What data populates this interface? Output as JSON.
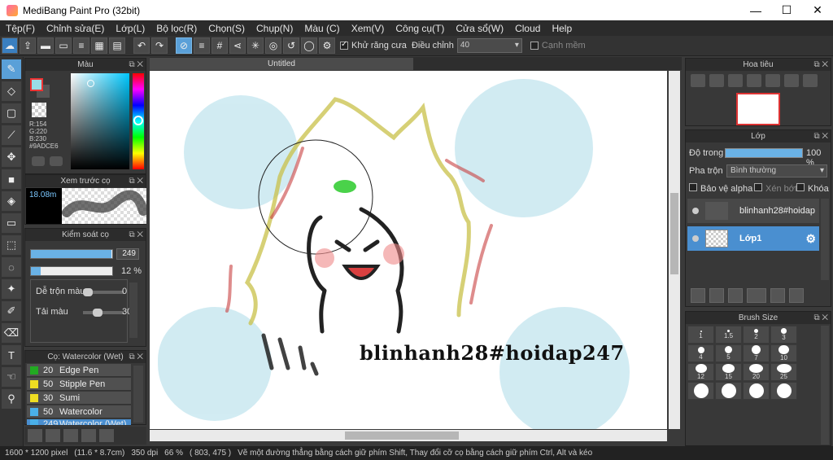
{
  "window": {
    "title": "MediBang Paint Pro (32bit)",
    "minimize": "—",
    "maximize": "☐",
    "close": "✕"
  },
  "menu": [
    "Tệp(F)",
    "Chỉnh sửa(E)",
    "Lớp(L)",
    "Bộ lọc(R)",
    "Chọn(S)",
    "Chụp(N)",
    "Màu (C)",
    "Xem(V)",
    "Công cụ(T)",
    "Cửa sổ(W)",
    "Cloud",
    "Help"
  ],
  "toolbar": {
    "antialias_label": "Khử răng cưa",
    "adjust_label": "Điều chỉnh",
    "adjust_value": "40",
    "smooth_label": "Cạnh mềm"
  },
  "color_panel": {
    "title": "Màu",
    "r": "R:154",
    "g": "G:220",
    "b": "B:230",
    "hex": "#9ADCE6"
  },
  "brush_preview": {
    "title": "Xem trước cọ",
    "size": "18.08m"
  },
  "brush_control": {
    "title": "Kiểm soát cọ",
    "size_value": "249",
    "opacity_value": "12 %",
    "blend_label": "Dễ trộn màu",
    "blend_value": "0",
    "amount_label": "Tải màu",
    "amount_value": "30",
    "size_fill": 0.99,
    "opacity_fill": 0.12
  },
  "brush_list": {
    "title": "Cọ: Watercolor (Wet)",
    "items": [
      {
        "size": "20",
        "name": "Edge Pen",
        "color": "#22aa22"
      },
      {
        "size": "50",
        "name": "Stipple Pen",
        "color": "#eedd22"
      },
      {
        "size": "30",
        "name": "Sumi",
        "color": "#eedd22"
      },
      {
        "size": "50",
        "name": "Watercolor",
        "color": "#4ab0e8"
      },
      {
        "size": "249",
        "name": "Watercolor (Wet)",
        "color": "#4ab0e8"
      }
    ]
  },
  "canvas": {
    "tab_title": "Untitled",
    "watermark": "blinhanh28#hoidap247"
  },
  "navigator": {
    "title": "Hoa tiêu"
  },
  "layers": {
    "title": "Lớp",
    "opacity_label": "Độ trong",
    "opacity_value": "100 %",
    "blend_label": "Pha trộn",
    "blend_value": "Bình thường",
    "protect_alpha": "Bảo vệ alpha",
    "clipping": "Xén bớt",
    "lock": "Khóa",
    "items": [
      {
        "name": "blinhanh28#hoidap",
        "selected": false
      },
      {
        "name": "Lớp1",
        "selected": true
      }
    ]
  },
  "brush_size": {
    "title": "Brush Size",
    "sizes": [
      "1",
      "1.5",
      "2",
      "3",
      "4",
      "5",
      "7",
      "10",
      "12",
      "15",
      "20",
      "25",
      "",
      "",
      "",
      ""
    ]
  },
  "status": {
    "pixels": "1600 * 1200 pixel",
    "physical": "(11.6 * 8.7cm)",
    "dpi": "350 dpi",
    "zoom": "66 %",
    "coords": "( 803, 475 )",
    "hint": "Vẽ một đường thẳng bằng cách giữ phím Shift, Thay đổi cỡ cọ bằng cách giữ phím Ctrl, Alt và kéo"
  }
}
